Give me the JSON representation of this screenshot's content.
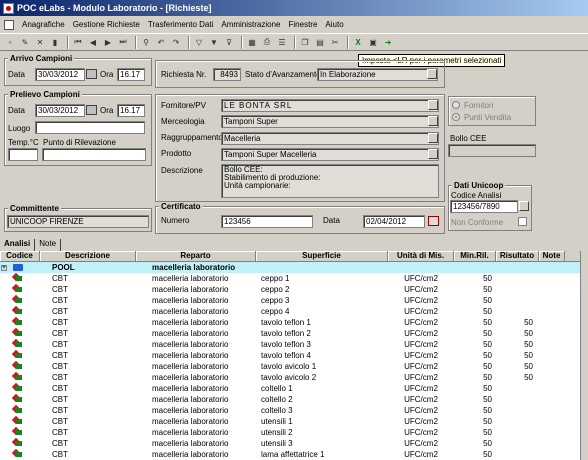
{
  "window": {
    "title": "POC eLabs - Modulo Laboratorio - [Richieste]"
  },
  "menu": [
    "Anagrafiche",
    "Gestione Richieste",
    "Trasferimento Dati",
    "Amministrazione",
    "Finestre",
    "Aiuto"
  ],
  "toolbar": {
    "icons": [
      "new-icon",
      "edit-icon",
      "delete-icon",
      "trash-icon",
      "first-icon",
      "prev-icon",
      "next-icon",
      "last-icon",
      "find-icon",
      "undo-icon",
      "redo-icon",
      "filter-icon",
      "filter-clear-icon",
      "filter-remove-icon",
      "grid-icon",
      "print-icon",
      "list-icon",
      "copy-icon",
      "paste-icon",
      "cut-icon",
      "excel-icon",
      "print-preview-icon",
      "export-icon"
    ],
    "tooltip": "Imposta <LR per i parametri selezionati"
  },
  "arrivo": {
    "title": "Arrivo Campioni",
    "data_label": "Data",
    "data_value": "30/03/2012",
    "ora_label": "Ora",
    "ora_value": "16.17"
  },
  "richiesta": {
    "nr_label": "Richiesta Nr.",
    "nr_value": "8493",
    "stato_label": "Stato d'Avanzamento",
    "stato_value": "In Elaborazione"
  },
  "prelievo": {
    "title": "Prelievo Campioni",
    "data_label": "Data",
    "data_value": "30/03/2012",
    "ora_label": "Ora",
    "ora_value": "16.17",
    "luogo_label": "Luogo",
    "temp_label": "Temp.°C",
    "punto_label": "Punto di Rilevazione"
  },
  "details": {
    "fornitore_label": "Fornitore/PV",
    "fornitore_value": "LE BONTA SRL",
    "merceologia_label": "Merceologia",
    "merceologia_value": "Tamponi Super",
    "raggruppamento_label": "Raggruppamento",
    "raggruppamento_value": "Macelleria",
    "prodotto_label": "Prodotto",
    "prodotto_value": "Tamponi Super Macelleria",
    "descrizione_label": "Descrizione",
    "descrizione_lines": [
      "Bollo CEE:",
      "Stabilimento di produzione:",
      "Unità campionarie:"
    ]
  },
  "radio": {
    "fornitori": "Fornitori",
    "punti_vendita": "Punti Vendita"
  },
  "bollo": {
    "label": "Bollo CEE"
  },
  "unicoop": {
    "title": "Dati Unicoop",
    "codice_label": "Codice Analisi",
    "codice_value": "123456/7890",
    "non_conforme": "Non Conforme"
  },
  "committente": {
    "title": "Committente",
    "value": "UNICOOP FIRENZE"
  },
  "certificato": {
    "title": "Certificato",
    "numero_label": "Numero",
    "numero_value": "123456",
    "data_label": "Data",
    "data_value": "02/04/2012"
  },
  "tabs": [
    "Analisi",
    "Note"
  ],
  "table": {
    "headers": [
      "Codice",
      "Descrizione",
      "Reparto",
      "Superficie",
      "Unità di Mis.",
      "Min.Ril.",
      "Risultato",
      "Note"
    ],
    "pool": {
      "descrizione": "POOL",
      "reparto": "macelleria laboratorio"
    },
    "rows": [
      {
        "descrizione": "CBT",
        "reparto": "macelleria laboratorio",
        "superficie": "ceppo 1",
        "unita": "UFC/cm2",
        "min": "50",
        "risultato": ""
      },
      {
        "descrizione": "CBT",
        "reparto": "macelleria laboratorio",
        "superficie": "ceppo 2",
        "unita": "UFC/cm2",
        "min": "50",
        "risultato": ""
      },
      {
        "descrizione": "CBT",
        "reparto": "macelleria laboratorio",
        "superficie": "ceppo 3",
        "unita": "UFC/cm2",
        "min": "50",
        "risultato": ""
      },
      {
        "descrizione": "CBT",
        "reparto": "macelleria laboratorio",
        "superficie": "ceppo 4",
        "unita": "UFC/cm2",
        "min": "50",
        "risultato": ""
      },
      {
        "descrizione": "CBT",
        "reparto": "macelleria laboratorio",
        "superficie": "tavolo teflon 1",
        "unita": "UFC/cm2",
        "min": "50",
        "risultato": "50"
      },
      {
        "descrizione": "CBT",
        "reparto": "macelleria laboratorio",
        "superficie": "tavolo teflon 2",
        "unita": "UFC/cm2",
        "min": "50",
        "risultato": "50"
      },
      {
        "descrizione": "CBT",
        "reparto": "macelleria laboratorio",
        "superficie": "tavolo teflon 3",
        "unita": "UFC/cm2",
        "min": "50",
        "risultato": "50"
      },
      {
        "descrizione": "CBT",
        "reparto": "macelleria laboratorio",
        "superficie": "tavolo teflon 4",
        "unita": "UFC/cm2",
        "min": "50",
        "risultato": "50"
      },
      {
        "descrizione": "CBT",
        "reparto": "macelleria laboratorio",
        "superficie": "tavolo avicolo 1",
        "unita": "UFC/cm2",
        "min": "50",
        "risultato": "50"
      },
      {
        "descrizione": "CBT",
        "reparto": "macelleria laboratorio",
        "superficie": "tavolo avicolo 2",
        "unita": "UFC/cm2",
        "min": "50",
        "risultato": "50"
      },
      {
        "descrizione": "CBT",
        "reparto": "macelleria laboratorio",
        "superficie": "coltello 1",
        "unita": "UFC/cm2",
        "min": "50",
        "risultato": ""
      },
      {
        "descrizione": "CBT",
        "reparto": "macelleria laboratorio",
        "superficie": "coltello 2",
        "unita": "UFC/cm2",
        "min": "50",
        "risultato": ""
      },
      {
        "descrizione": "CBT",
        "reparto": "macelleria laboratorio",
        "superficie": "coltello 3",
        "unita": "UFC/cm2",
        "min": "50",
        "risultato": ""
      },
      {
        "descrizione": "CBT",
        "reparto": "macelleria laboratorio",
        "superficie": "utensili 1",
        "unita": "UFC/cm2",
        "min": "50",
        "risultato": ""
      },
      {
        "descrizione": "CBT",
        "reparto": "macelleria laboratorio",
        "superficie": "utensili 2",
        "unita": "UFC/cm2",
        "min": "50",
        "risultato": ""
      },
      {
        "descrizione": "CBT",
        "reparto": "macelleria laboratorio",
        "superficie": "utensili 3",
        "unita": "UFC/cm2",
        "min": "50",
        "risultato": ""
      },
      {
        "descrizione": "CBT",
        "reparto": "macelleria laboratorio",
        "superficie": "lama affettatrice 1",
        "unita": "UFC/cm2",
        "min": "50",
        "risultato": ""
      }
    ]
  }
}
